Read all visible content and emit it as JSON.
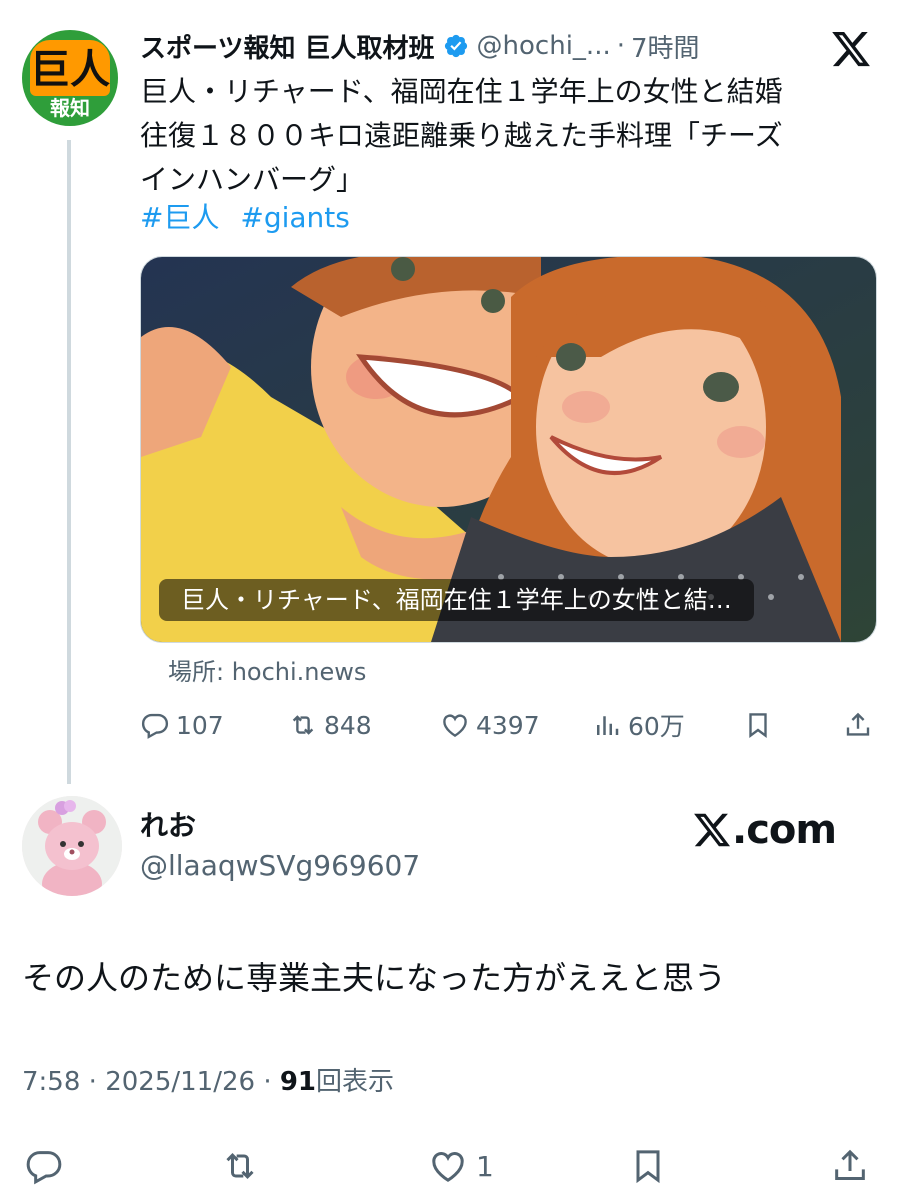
{
  "quoted_post": {
    "logo_top": "巨人",
    "logo_bottom": "報知",
    "author_name": "スポーツ報知 巨人取材班",
    "handle": "@hochi_...",
    "separator": "·",
    "time": "7時間",
    "body": "巨人・リチャード、福岡在住１学年上の女性と結婚\n往復１８００キロ遠距離乗り越えた手料理「チーズ\nインハンバーグ」",
    "hashtags": [
      "#巨人",
      "#giants"
    ],
    "card_caption": "巨人・リチャード、福岡在住１学年上の女性と結…",
    "source": "場所: hochi.news",
    "stats": {
      "replies": "107",
      "reposts": "848",
      "likes": "4397",
      "views": "60万"
    }
  },
  "reply_post": {
    "author_name": "れお",
    "handle": "@llaaqwSVg969607",
    "watermark": "X.com",
    "text": "その人のために専業主夫になった方がええと思う",
    "time": "7:58",
    "date": "2025/11/26",
    "separator": "·",
    "views_count": "91",
    "views_label": "回表示",
    "likes": "1"
  },
  "icons": [
    "verified-badge-icon",
    "x-logo-icon",
    "reply-icon",
    "repost-icon",
    "like-icon",
    "views-icon",
    "bookmark-icon",
    "share-icon"
  ],
  "colors": {
    "accent": "#1d9bf0",
    "secondary_text": "#536471",
    "thread_line": "#cfd9de"
  }
}
